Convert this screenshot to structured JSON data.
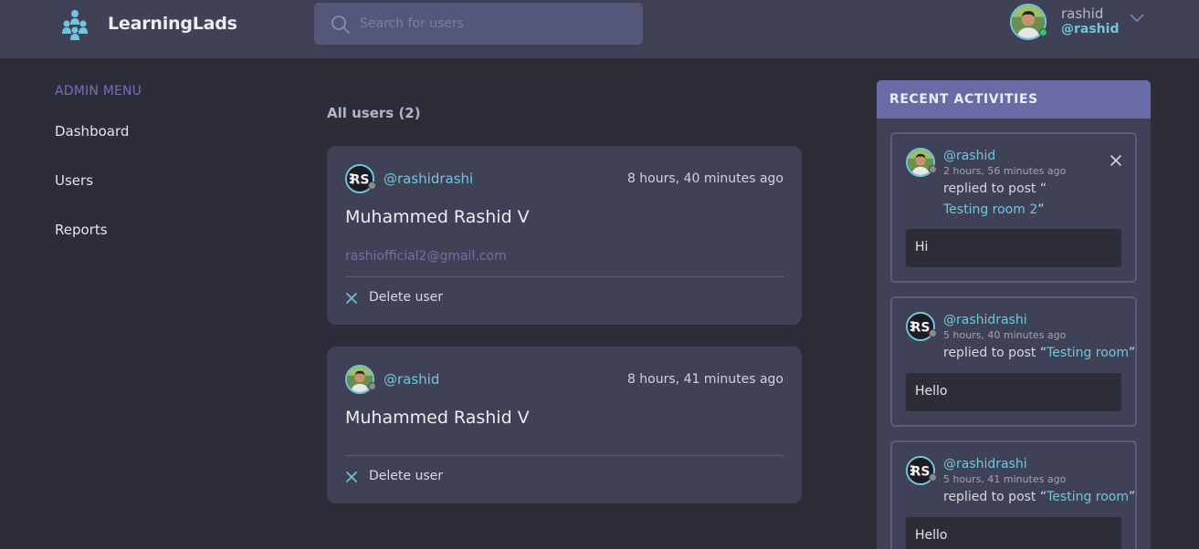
{
  "header": {
    "brand": "LearningLads",
    "search_placeholder": "Search for users",
    "user_name": "rashid",
    "user_handle": "@rashid"
  },
  "sidebar": {
    "title": "ADMIN MENU",
    "items": [
      {
        "label": "Dashboard"
      },
      {
        "label": "Users"
      },
      {
        "label": "Reports"
      }
    ]
  },
  "main": {
    "all_users_label": "All users (2)",
    "users": [
      {
        "handle": "@rashidrashi",
        "time": "8 hours, 40 minutes ago",
        "name": "Muhammed Rashid V",
        "email": "rashiofficial2@gmail.com",
        "delete_label": "Delete user",
        "avatar_icon": "rs-logo-avatar"
      },
      {
        "handle": "@rashid",
        "time": "8 hours, 41 minutes ago",
        "name": "Muhammed Rashid V",
        "email": "",
        "delete_label": "Delete user",
        "avatar_icon": "person-photo-avatar"
      }
    ]
  },
  "activities": {
    "title": "RECENT ACTIVITIES",
    "items": [
      {
        "handle": "@rashid",
        "time": "2 hours, 56 minutes ago",
        "prefix": "replied to post “",
        "post": "Testing room 2",
        "suffix": "”",
        "message": "Hi"
      },
      {
        "handle": "@rashidrashi",
        "time": "5 hours, 40 minutes ago",
        "prefix": "replied to post “",
        "post": "Testing room",
        "suffix": "”",
        "message": "Hello"
      },
      {
        "handle": "@rashidrashi",
        "time": "5 hours, 41 minutes ago",
        "prefix": "replied to post “",
        "post": "Testing room",
        "suffix": "”",
        "message": "Hello"
      }
    ]
  },
  "colors": {
    "accent": "#71c6dd",
    "background": "#2d2d39",
    "card": "#3f4156",
    "activities_header": "#696ba6",
    "online": "#32c766"
  }
}
